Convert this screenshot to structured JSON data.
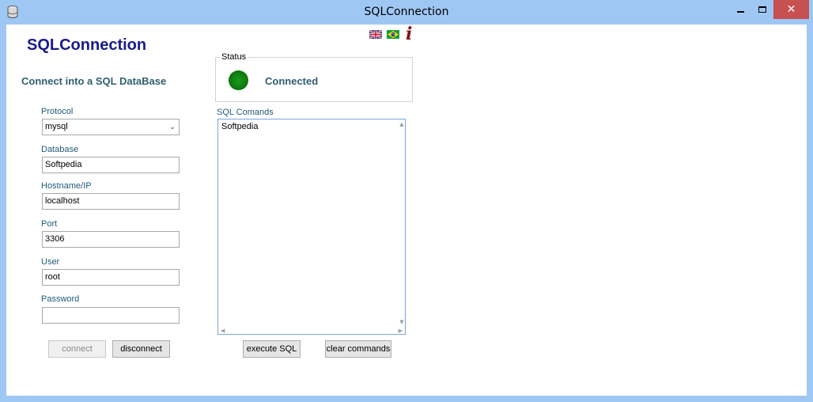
{
  "window": {
    "title": "SQLConnection",
    "close_symbol": "✕"
  },
  "header": {
    "heading": "SQLConnection",
    "subheading": "Connect into a SQL DataBase"
  },
  "form": {
    "protocol_label": "Protocol",
    "protocol_value": "mysql",
    "database_label": "Database",
    "database_value": "Softpedia",
    "hostname_label": "Hostname/IP",
    "hostname_value": "localhost",
    "port_label": "Port",
    "port_value": "3306",
    "user_label": "User",
    "user_value": "root",
    "password_label": "Password",
    "password_value": ""
  },
  "buttons": {
    "connect": "connect",
    "disconnect": "disconnect",
    "execute_sql": "execute SQL",
    "clear_commands": "clear commands"
  },
  "status": {
    "legend": "Status",
    "text": "Connected",
    "light_color": "#118011"
  },
  "sql": {
    "label": "SQL Comands",
    "content": "Softpedia"
  },
  "icons": {
    "language_flags": [
      "uk-flag-icon",
      "brazil-flag-icon"
    ],
    "info": "info-icon",
    "app": "database-icon"
  },
  "colors": {
    "frame": "#9fc7f3",
    "heading": "#1a1a8c",
    "label": "#1f5a7a",
    "close_button": "#c75050"
  }
}
